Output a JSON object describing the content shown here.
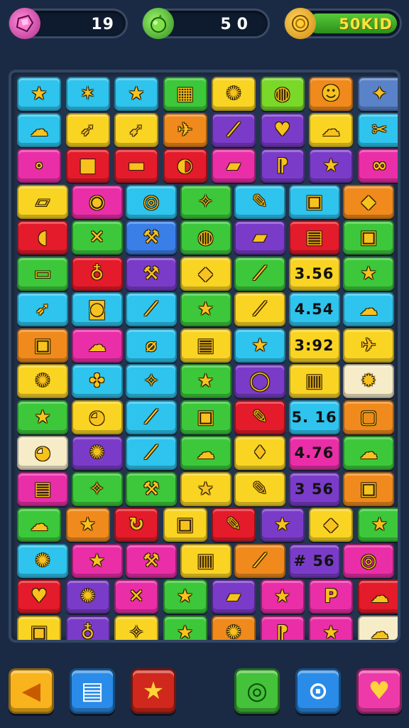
{
  "hud": {
    "gems": "19",
    "moves": "50",
    "coins": "50KID",
    "gem_icon": "pink-gem-icon",
    "moves_icon": "green-fruit-icon",
    "coin_icon": "gold-coin-icon"
  },
  "palette": {
    "cyan": "#2ec4ee",
    "yellow": "#f9d423",
    "green": "#3cc83a",
    "orange": "#f08a1c",
    "magenta": "#ea2ea8",
    "red": "#e41b2a",
    "purple": "#7a3cc8",
    "cream": "#f6ecc8",
    "blue": "#3a7ee8",
    "lime": "#7ad828",
    "steel": "#5a82c8"
  },
  "board": {
    "rows": [
      [
        {
          "c": "cyan",
          "s": "★",
          "i": "star-icon"
        },
        {
          "c": "cyan",
          "s": "✶",
          "i": "sparkle-icon"
        },
        {
          "c": "cyan",
          "s": "★",
          "i": "star-icon"
        },
        {
          "c": "green",
          "s": "▦",
          "i": "calendar-icon"
        },
        {
          "c": "yellow",
          "s": "✺",
          "i": "cookie-icon"
        },
        {
          "c": "lime",
          "s": "◍",
          "i": "ball-icon"
        },
        {
          "c": "orange",
          "s": "☻",
          "i": "face-icon"
        },
        {
          "c": "steel",
          "s": "✦",
          "i": "sparkle-icon"
        }
      ],
      [
        {
          "c": "cyan",
          "s": "☁",
          "i": "blob-icon"
        },
        {
          "c": "yellow",
          "s": "➶",
          "i": "arrow-icon"
        },
        {
          "c": "yellow",
          "s": "➹",
          "i": "arrow-icon"
        },
        {
          "c": "orange",
          "s": "✈",
          "i": "plane-icon"
        },
        {
          "c": "purple",
          "s": "⟋",
          "i": "bat-icon"
        },
        {
          "c": "purple",
          "s": "♥",
          "i": "heart-icon"
        },
        {
          "c": "yellow",
          "s": "☁",
          "i": "cloud-icon"
        },
        {
          "c": "cyan",
          "s": "✂",
          "i": "scissors-icon"
        }
      ],
      [
        {
          "c": "magenta",
          "s": "∘",
          "i": "bubbles-icon"
        },
        {
          "c": "red",
          "s": "■",
          "i": "bag-icon"
        },
        {
          "c": "red",
          "s": "▬",
          "i": "domino-icon"
        },
        {
          "c": "red",
          "s": "◐",
          "i": "clock-icon"
        },
        {
          "c": "magenta",
          "s": "▰",
          "i": "eraser-icon"
        },
        {
          "c": "purple",
          "s": "⁋",
          "i": "note-icon"
        },
        {
          "c": "purple",
          "s": "★",
          "i": "star-icon"
        },
        {
          "c": "magenta",
          "s": "∞",
          "i": "link-icon"
        }
      ],
      [
        {
          "c": "yellow",
          "s": "▱",
          "i": "eraser-icon"
        },
        {
          "c": "magenta",
          "s": "◉",
          "i": "pin-icon"
        },
        {
          "c": "cyan",
          "s": "◎",
          "i": "donut-icon"
        },
        {
          "c": "green",
          "s": "✧",
          "i": "star-icon"
        },
        {
          "c": "cyan",
          "s": "✎",
          "i": "brush-icon"
        },
        {
          "c": "cyan",
          "s": "▣",
          "i": "box-icon"
        },
        {
          "c": "orange",
          "s": "◆",
          "i": "leaf-icon"
        }
      ],
      [
        {
          "c": "red",
          "s": "◖",
          "i": "shoe-icon"
        },
        {
          "c": "green",
          "s": "✕",
          "i": "cross-icon"
        },
        {
          "c": "blue",
          "s": "⚒",
          "i": "hammer-icon"
        },
        {
          "c": "green",
          "s": "◍",
          "i": "ball-icon"
        },
        {
          "c": "purple",
          "s": "▰",
          "i": "capsule-icon"
        },
        {
          "c": "red",
          "s": "▤",
          "i": "jar-icon"
        },
        {
          "c": "green",
          "s": "▣",
          "i": "bag-icon"
        }
      ],
      [
        {
          "c": "green",
          "s": "▭",
          "i": "bag-icon"
        },
        {
          "c": "red",
          "s": "♁",
          "i": "bulb-icon"
        },
        {
          "c": "purple",
          "s": "⚒",
          "i": "hammer-icon"
        },
        {
          "c": "yellow",
          "s": "◆",
          "i": "eraser-icon"
        },
        {
          "c": "green",
          "s": "⟋",
          "i": "knife-icon"
        },
        {
          "c": "yellow",
          "t": "3.56"
        },
        {
          "c": "green",
          "s": "★",
          "i": "star-icon"
        }
      ],
      [
        {
          "c": "cyan",
          "s": "➶",
          "i": "arrow-icon"
        },
        {
          "c": "cyan",
          "s": "◙",
          "i": "domino-icon"
        },
        {
          "c": "cyan",
          "s": "⟋",
          "i": "knife-icon"
        },
        {
          "c": "green",
          "s": "★",
          "i": "star-icon"
        },
        {
          "c": "yellow",
          "s": "⟋",
          "i": "brush-icon"
        },
        {
          "c": "cyan",
          "t": "4.54"
        },
        {
          "c": "cyan",
          "s": "☁",
          "i": "blob-icon"
        }
      ],
      [
        {
          "c": "orange",
          "s": "▣",
          "i": "bag-icon"
        },
        {
          "c": "magenta",
          "s": "☁",
          "i": "blob-icon"
        },
        {
          "c": "cyan",
          "s": "⌀",
          "i": "popsicle-icon"
        },
        {
          "c": "yellow",
          "s": "▤",
          "i": "jar-icon"
        },
        {
          "c": "cyan",
          "s": "★",
          "i": "star-icon"
        },
        {
          "c": "yellow",
          "t": "3:92"
        },
        {
          "c": "yellow",
          "s": "✈",
          "i": "plane-icon"
        }
      ],
      [
        {
          "c": "yellow",
          "s": "✺",
          "i": "cookie-icon"
        },
        {
          "c": "cyan",
          "s": "✤",
          "i": "leaf-icon"
        },
        {
          "c": "cyan",
          "s": "✧",
          "i": "star-icon"
        },
        {
          "c": "green",
          "s": "★",
          "i": "star-icon"
        },
        {
          "c": "purple",
          "s": "◯",
          "i": "ring-icon"
        },
        {
          "c": "yellow",
          "s": "▥",
          "i": "jar-icon"
        },
        {
          "c": "cream",
          "s": "✹",
          "i": "burst-icon"
        }
      ],
      [
        {
          "c": "green",
          "s": "★",
          "i": "star-icon"
        },
        {
          "c": "yellow",
          "s": "◕",
          "i": "candy-icon"
        },
        {
          "c": "cyan",
          "s": "⟋",
          "i": "knife-icon"
        },
        {
          "c": "green",
          "s": "▣",
          "i": "bag-icon"
        },
        {
          "c": "red",
          "s": "✎",
          "i": "brush-icon"
        },
        {
          "c": "cyan",
          "t": "5. 16"
        },
        {
          "c": "orange",
          "s": "▢",
          "i": "frame-icon"
        }
      ],
      [
        {
          "c": "cream",
          "s": "◕",
          "i": "candy-icon"
        },
        {
          "c": "purple",
          "s": "✺",
          "i": "cookie-icon"
        },
        {
          "c": "cyan",
          "s": "⟋",
          "i": "knife-icon"
        },
        {
          "c": "green",
          "s": "☁",
          "i": "blob-icon"
        },
        {
          "c": "yellow",
          "s": "♦",
          "i": "apple-icon"
        },
        {
          "c": "magenta",
          "t": "4.76"
        },
        {
          "c": "green",
          "s": "☁",
          "i": "blob-icon"
        }
      ],
      [
        {
          "c": "magenta",
          "s": "▤",
          "i": "jar-icon"
        },
        {
          "c": "green",
          "s": "✧",
          "i": "star-icon"
        },
        {
          "c": "green",
          "s": "⚒",
          "i": "hammer-icon"
        },
        {
          "c": "yellow",
          "s": "★",
          "i": "star-icon"
        },
        {
          "c": "yellow",
          "s": "✎",
          "i": "brush-icon"
        },
        {
          "c": "purple",
          "t": "3 56"
        },
        {
          "c": "orange",
          "s": "▣",
          "i": "bag-icon"
        }
      ],
      [
        {
          "c": "green",
          "s": "☁",
          "i": "blob-icon"
        },
        {
          "c": "orange",
          "s": "★",
          "i": "star-icon"
        },
        {
          "c": "red",
          "s": "↻",
          "i": "swirl-icon"
        },
        {
          "c": "yellow",
          "s": "▣",
          "i": "bag-icon"
        },
        {
          "c": "red",
          "s": "✎",
          "i": "brush-icon"
        },
        {
          "c": "purple",
          "s": "★",
          "i": "star-icon"
        },
        {
          "c": "yellow",
          "s": "◆",
          "i": "leaf-icon"
        },
        {
          "c": "green",
          "s": "★",
          "i": "star-icon"
        }
      ],
      [
        {
          "c": "cyan",
          "s": "✺",
          "i": "cookie-icon"
        },
        {
          "c": "magenta",
          "s": "★",
          "i": "star-icon"
        },
        {
          "c": "magenta",
          "s": "⚒",
          "i": "hammer-icon"
        },
        {
          "c": "yellow",
          "s": "▥",
          "i": "box-icon"
        },
        {
          "c": "orange",
          "s": "⟋",
          "i": "knife-icon"
        },
        {
          "c": "purple",
          "t": "# 56"
        },
        {
          "c": "magenta",
          "s": "◎",
          "i": "ring-icon"
        }
      ],
      [
        {
          "c": "red",
          "s": "♥",
          "i": "heart-icon"
        },
        {
          "c": "purple",
          "s": "✺",
          "i": "cookie-icon"
        },
        {
          "c": "magenta",
          "s": "✕",
          "i": "cross-icon"
        },
        {
          "c": "green",
          "s": "★",
          "i": "star-icon"
        },
        {
          "c": "purple",
          "s": "▰",
          "i": "eraser-icon"
        },
        {
          "c": "magenta",
          "s": "★",
          "i": "star-icon"
        },
        {
          "c": "magenta",
          "s": "P",
          "i": "p-icon"
        },
        {
          "c": "red",
          "s": "☁",
          "i": "blob-icon"
        }
      ],
      [
        {
          "c": "yellow",
          "s": "▣",
          "i": "bag-icon"
        },
        {
          "c": "purple",
          "s": "♁",
          "i": "bulb-icon"
        },
        {
          "c": "yellow",
          "s": "✧",
          "i": "star-icon"
        },
        {
          "c": "green",
          "s": "★",
          "i": "star-icon"
        },
        {
          "c": "orange",
          "s": "✺",
          "i": "cookie-icon"
        },
        {
          "c": "magenta",
          "s": "⁋",
          "i": "note-icon"
        },
        {
          "c": "magenta",
          "s": "★",
          "i": "star-icon"
        },
        {
          "c": "cream",
          "s": "☁",
          "i": "blob-icon"
        }
      ]
    ]
  },
  "buttons": [
    {
      "name": "back-button",
      "c": "#f9b31c",
      "g": "◀",
      "fg": "#c85a00",
      "icon": "back-arrow-icon"
    },
    {
      "name": "menu-button",
      "c": "#2a8ce8",
      "g": "▤",
      "fg": "#ffffff",
      "icon": "book-icon"
    },
    {
      "name": "favorite-button",
      "c": "#d0281c",
      "g": "★",
      "fg": "#ffd43a",
      "icon": "star-icon"
    },
    {
      "name": "search-button",
      "c": "#44c23a",
      "g": "◎",
      "fg": "#0c4a0c",
      "icon": "magnifier-icon"
    },
    {
      "name": "zoom-button",
      "c": "#2a8ce8",
      "g": "⊙",
      "fg": "#ffffff",
      "icon": "magnifier-icon"
    },
    {
      "name": "like-button",
      "c": "#ee3aa8",
      "g": "♥",
      "fg": "#ffd43a",
      "icon": "heart-icon"
    }
  ]
}
